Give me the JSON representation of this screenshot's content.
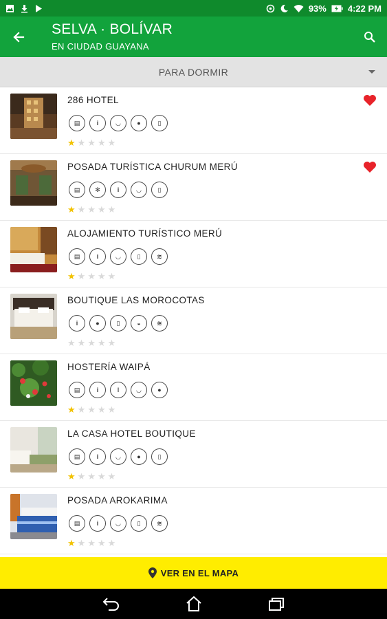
{
  "status_bar": {
    "battery": "93%",
    "time": "4:22 PM"
  },
  "header": {
    "title": "SELVA · BOLÍVAR",
    "subtitle": "EN CIUDAD GUAYANA"
  },
  "filter": {
    "selected": "PARA DORMIR"
  },
  "hotels": [
    {
      "name": "286 HOTEL",
      "favorite": true,
      "rating": 1,
      "max_rating": 5,
      "amenities": [
        "atm-icon",
        "info-icon",
        "smile-icon",
        "restaurant-icon",
        "phone-icon"
      ]
    },
    {
      "name": "POSADA TURÍSTICA CHURUM MERÚ",
      "favorite": true,
      "rating": 1,
      "max_rating": 5,
      "amenities": [
        "atm-icon",
        "fan-icon",
        "info-icon",
        "smile-icon",
        "phone-icon"
      ]
    },
    {
      "name": "ALOJAMIENTO TURÍSTICO MERÚ",
      "favorite": false,
      "rating": 1,
      "max_rating": 5,
      "amenities": [
        "atm-icon",
        "info-icon",
        "smile-icon",
        "phone-icon",
        "wifi-icon"
      ]
    },
    {
      "name": "BOUTIQUE LAS MOROCOTAS",
      "favorite": false,
      "rating": 0,
      "max_rating": 5,
      "amenities": [
        "info-icon",
        "restaurant-icon",
        "phone-icon",
        "bath-icon",
        "wifi-icon"
      ]
    },
    {
      "name": "HOSTERÍA WAIPÁ",
      "favorite": false,
      "rating": 1,
      "max_rating": 5,
      "amenities": [
        "atm-icon",
        "info-icon",
        "thermometer-icon",
        "smile-icon",
        "restaurant-icon"
      ]
    },
    {
      "name": "LA CASA HOTEL BOUTIQUE",
      "favorite": false,
      "rating": 1,
      "max_rating": 5,
      "amenities": [
        "atm-icon",
        "info-icon",
        "smile-icon",
        "restaurant-icon",
        "phone-icon"
      ]
    },
    {
      "name": "POSADA AROKARIMA",
      "favorite": false,
      "rating": 1,
      "max_rating": 5,
      "amenities": [
        "atm-icon",
        "info-icon",
        "smile-icon",
        "phone-icon",
        "wifi-icon"
      ]
    }
  ],
  "map_button": {
    "label": "VER EN EL MAPA"
  },
  "colors": {
    "primary": "#12a33c",
    "status_bar": "#0f8a2c",
    "filter_bg": "#e3e3e3",
    "map_button": "#ffed00",
    "favorite": "#e8232a",
    "star_on": "#f2c200",
    "star_off": "#d9d9d9"
  }
}
